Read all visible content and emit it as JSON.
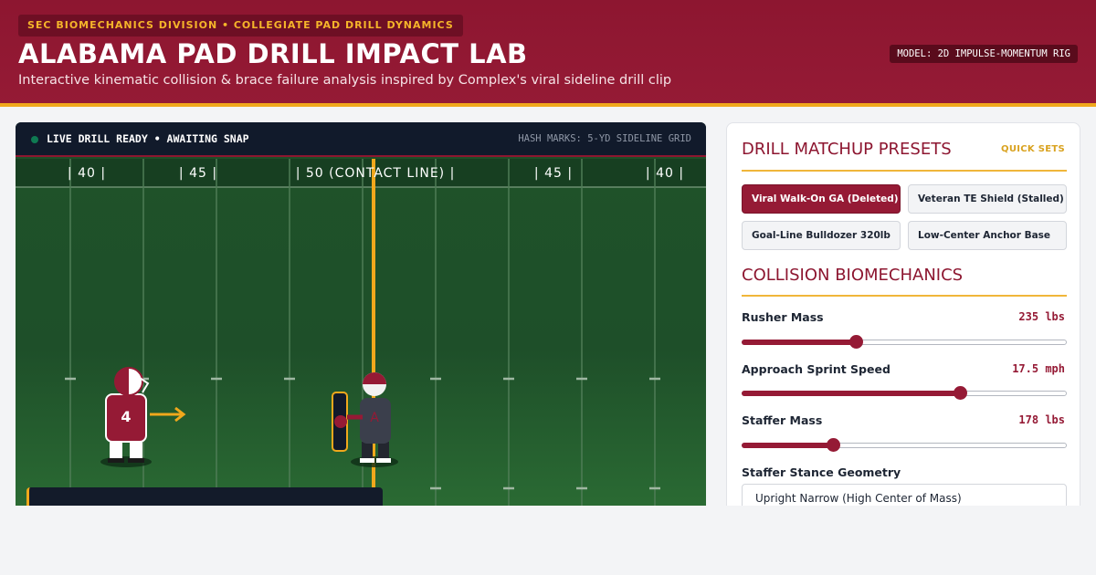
{
  "header": {
    "division": "SEC BIOMECHANICS DIVISION  •  COLLEGIATE PAD DRILL DYNAMICS",
    "title": "ALABAMA PAD DRILL IMPACT LAB",
    "subtitle": "Interactive kinematic collision & brace failure analysis inspired by Complex's viral sideline drill clip",
    "model": "MODEL: 2D IMPULSE-MOMENTUM RIG"
  },
  "field": {
    "status": "LIVE DRILL READY • AWAITING SNAP",
    "hash_marks": "HASH MARKS: 5-YD SIDELINE GRID",
    "yard_labels": [
      "| 40 |",
      "| 45 |",
      "| 50 (CONTACT LINE) |",
      "| 45 |",
      "| 40 |"
    ],
    "rusher_number": "4",
    "colors": {
      "field": "#1e4f29",
      "crimson": "#951a35",
      "gold": "#f0a81c",
      "staffer": "#3b3f4c"
    }
  },
  "presets": {
    "title": "DRILL MATCHUP PRESETS",
    "quick_label": "QUICK SETS",
    "items": [
      {
        "label": "Viral Walk-On GA (Deleted)",
        "active": true
      },
      {
        "label": "Veteran TE Shield (Stalled)",
        "active": false
      },
      {
        "label": "Goal-Line Bulldozer 320lb",
        "active": false
      },
      {
        "label": "Low-Center Anchor Base",
        "active": false
      }
    ]
  },
  "biomech": {
    "title": "COLLISION BIOMECHANICS",
    "rusher_mass": {
      "label": "Rusher Mass",
      "value": "235 lbs",
      "fraction": 0.35
    },
    "sprint_speed": {
      "label": "Approach Sprint Speed",
      "value": "17.5 mph",
      "fraction": 0.67
    },
    "staffer_mass": {
      "label": "Staffer Mass",
      "value": "178 lbs",
      "fraction": 0.28
    },
    "stance": {
      "label": "Staffer Stance Geometry",
      "selected": "Upright Narrow (High Center of Mass)"
    }
  }
}
